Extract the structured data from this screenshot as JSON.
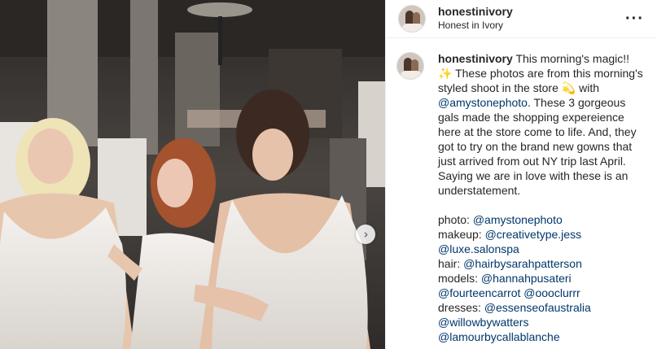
{
  "post": {
    "username": "honestinivory",
    "location": "Honest in Ivory",
    "more_icon": "more-horizontal-icon",
    "next_icon": "chevron-right-icon"
  },
  "caption": {
    "username": "honestinivory",
    "text_1": "This morning's magic!!",
    "sparkles": "✨",
    "text_2": "These photos are from this morning's styled shoot in the store",
    "dizzy": "💫",
    "text_3": "with",
    "mention_photographer": "@amystonephoto",
    "text_4": ". These 3 gorgeous gals made the shopping expereience here at the store come to life. And, they got to try on the brand new gowns that just arrived from out NY trip last April. Saying we are in love with these is an understatement.",
    "credits": [
      {
        "label": "photo:",
        "handles": [
          "@amystonephoto"
        ]
      },
      {
        "label": "makeup:",
        "handles": [
          "@creativetype.jess",
          "@luxe.salonspa"
        ]
      },
      {
        "label": "hair:",
        "handles": [
          "@hairbysarahpatterson"
        ]
      },
      {
        "label": "models:",
        "handles": [
          "@hannahpusateri",
          "@fourteencarrot",
          "@oooclurrr"
        ]
      },
      {
        "label": "dresses:",
        "handles": [
          "@essenseofaustralia",
          "@willowbywatters",
          "@lamourbycallablanche"
        ]
      }
    ]
  }
}
